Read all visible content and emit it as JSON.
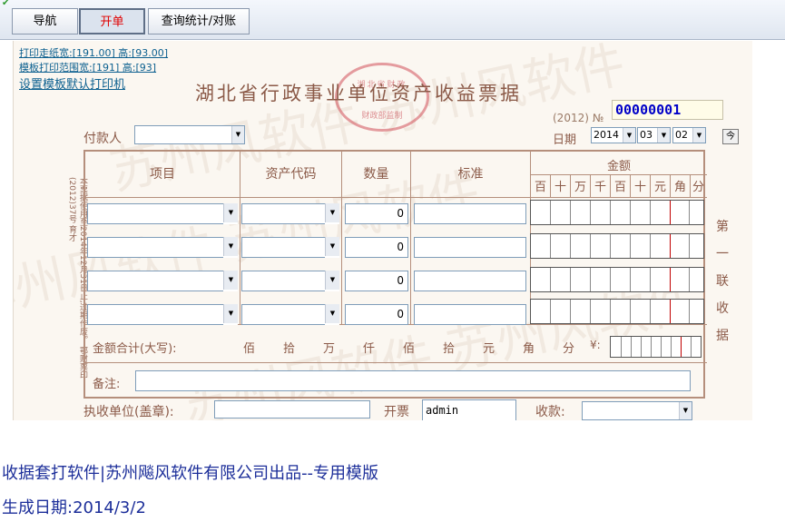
{
  "toolbar": {
    "tabs": [
      {
        "label": "导航",
        "active": false
      },
      {
        "label": "开单",
        "active": true
      },
      {
        "label": "查询统计/对账",
        "active": false
      }
    ],
    "active_color": "#e00000"
  },
  "links": {
    "paper_size": "打印走纸宽:[191.00] 高:[93.00]",
    "print_range": "模板打印范围宽:[191] 高:[93]",
    "set_printer": "设置模板默认打印机"
  },
  "bill": {
    "title": "湖北省行政事业单位资产收益票据",
    "stamp_top": "湖北省财政",
    "stamp_bottom": "财政部监制",
    "year_label": "(2012) №",
    "voucher_no": "00000001",
    "date_label": "日期",
    "date": {
      "year": "2014",
      "month": "03",
      "day": "02"
    },
    "today_button": "今",
    "payer_label": "付款人",
    "payer_value": "",
    "columns": {
      "item": "项目",
      "asset_code": "资产代码",
      "quantity": "数量",
      "standard": "标准",
      "amount": "金额"
    },
    "amount_digits": [
      "百",
      "十",
      "万",
      "千",
      "百",
      "十",
      "元",
      "角",
      "分"
    ],
    "rows": [
      {
        "item": "",
        "asset_code": "",
        "quantity": "0",
        "standard": ""
      },
      {
        "item": "",
        "asset_code": "",
        "quantity": "0",
        "standard": ""
      },
      {
        "item": "",
        "asset_code": "",
        "quantity": "0",
        "standard": ""
      },
      {
        "item": "",
        "asset_code": "",
        "quantity": "0",
        "standard": ""
      }
    ],
    "total_label": "金额合计(大写):",
    "total_units": [
      "佰",
      "拾",
      "万",
      "仟",
      "佰",
      "拾",
      "元",
      "角",
      "分"
    ],
    "yen_sign": "¥:",
    "remark_label": "备注:",
    "side_note": "本票据使用至2014年12月31日止,过期作废。 鄂财票印(2012)37号  育才",
    "copy_label": [
      "第",
      "一",
      "联",
      "收",
      "据"
    ],
    "unit_label": "执收单位(盖章):",
    "invoice_label": "开票",
    "invoice_value": "admin",
    "collect_label": "收款:"
  },
  "footer": {
    "line1": "收据套打软件|苏州飚风软件有限公司出品--专用模版",
    "line2": "生成日期:2014/3/2"
  },
  "colors": {
    "form_text": "#8b5a48",
    "voucher_no": "#0000c8",
    "footer_text": "#1d2f9a"
  }
}
